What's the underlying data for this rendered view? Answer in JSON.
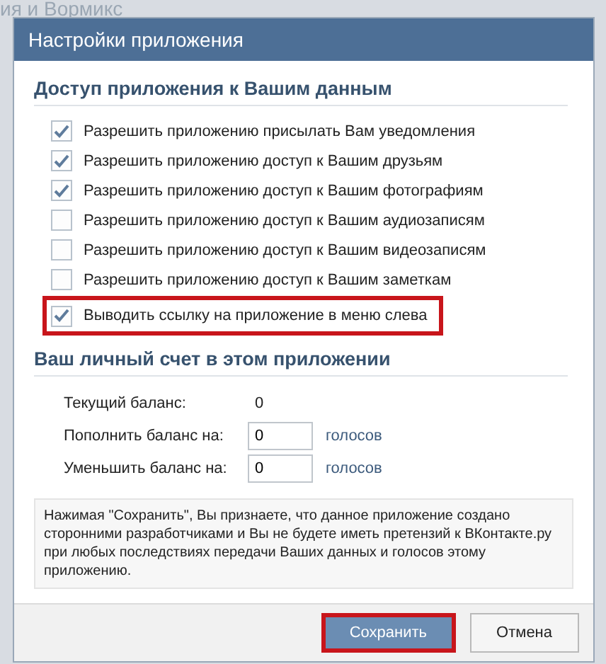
{
  "background_text": "ия и Вормикс",
  "window": {
    "title": "Настройки приложения"
  },
  "access_section": {
    "heading": "Доступ приложения к Вашим данным",
    "options": [
      {
        "label": "Разрешить приложению присылать Вам уведомления",
        "checked": true,
        "highlighted": false
      },
      {
        "label": "Разрешить приложению доступ к Вашим друзьям",
        "checked": true,
        "highlighted": false
      },
      {
        "label": "Разрешить приложению доступ к Вашим фотографиям",
        "checked": true,
        "highlighted": false
      },
      {
        "label": "Разрешить приложению доступ к Вашим аудиозаписям",
        "checked": false,
        "highlighted": false
      },
      {
        "label": "Разрешить приложению доступ к Вашим видеозаписям",
        "checked": false,
        "highlighted": false
      },
      {
        "label": "Разрешить приложению доступ к Вашим заметкам",
        "checked": false,
        "highlighted": false
      },
      {
        "label": "Выводить ссылку на приложение в меню слева",
        "checked": true,
        "highlighted": true
      }
    ]
  },
  "balance_section": {
    "heading": "Ваш личный счет в этом приложении",
    "rows": [
      {
        "kind": "text",
        "label": "Текущий баланс:",
        "value": "0"
      },
      {
        "kind": "input",
        "label": "Пополнить баланс на:",
        "value": "0",
        "unit": "голосов"
      },
      {
        "kind": "input",
        "label": "Уменьшить баланс на:",
        "value": "0",
        "unit": "голосов"
      }
    ]
  },
  "notice": "Нажимая \"Сохранить\", Вы признаете, что данное приложение создано сторонними разработчиками и Вы не будете иметь претензий к ВКонтакте.ру при любых последствиях передачи Ваших данных и голосов этому приложению.",
  "buttons": [
    {
      "label": "Сохранить",
      "kind": "primary",
      "highlighted": true
    },
    {
      "label": "Отмена",
      "kind": "secondary",
      "highlighted": false
    }
  ]
}
